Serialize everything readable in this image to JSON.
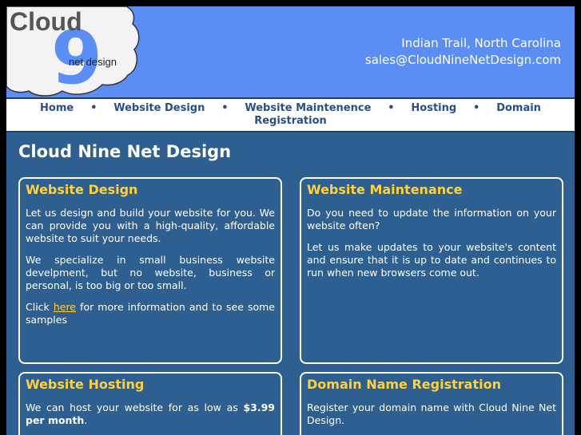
{
  "logo": {
    "word": "Cloud",
    "digit": "9",
    "sub": "net design"
  },
  "contact": {
    "location": "Indian Trail, North Carolina",
    "email": "sales@CloudNineNetDesign.com"
  },
  "nav": {
    "items": [
      "Home",
      "Website Design",
      "Website Maintenence",
      "Hosting",
      "Domain Registration"
    ],
    "domain_first": "Domain",
    "domain_second": "Registration",
    "separator": "•"
  },
  "main": {
    "title": "Cloud Nine Net Design",
    "boxes": [
      {
        "heading": "Website Design",
        "p1": "Let us design and build your website for you. We can provide you with a high-quality, affordable website to suit your needs.",
        "p2": "We specialize in small business website develpment, but no website, business or personal, is too big or too small.",
        "p3_before": "Click ",
        "p3_link": "here",
        "p3_after": " for more information and to see some samples"
      },
      {
        "heading": "Website Maintenance",
        "p1": "Do you need to update the information on your website often?",
        "p2": "Let us make updates to your website's content and ensure that it is up to date and continues to run when new browsers come out."
      },
      {
        "heading": "Website Hosting",
        "p1_before": "We can host your website for as low as ",
        "p1_bold": "$3.99 per month",
        "p1_after": "."
      },
      {
        "heading": "Domain Name Registration",
        "p1": "Register your domain name with Cloud Nine Net Design."
      }
    ]
  },
  "colors": {
    "header_blue": "#5b8ef5",
    "content_blue": "#2e5f91",
    "heading_yellow": "#ffd23a",
    "nav_text": "#2a4e8b"
  }
}
